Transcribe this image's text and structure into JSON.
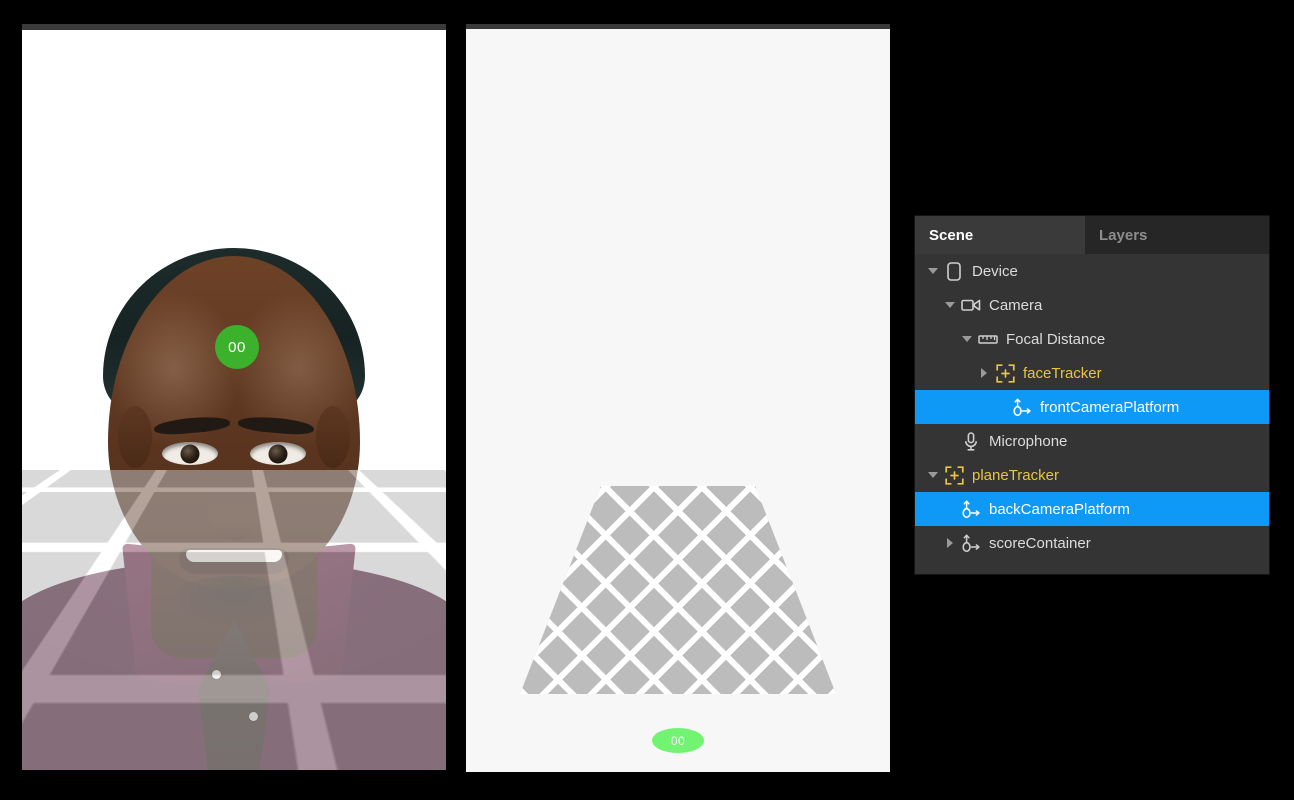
{
  "viewports": {
    "front": {
      "name": "front-camera-preview",
      "score_badge": {
        "text": "00",
        "color": "#3cb22c",
        "text_color": "#ffffff"
      },
      "background": "#ffffff",
      "floor_color": "#b9b9b9",
      "grid_line_color": "#ffffff"
    },
    "back": {
      "name": "back-camera-preview",
      "score_badge": {
        "text": "00",
        "color": "#72f472",
        "text_color": "#ffffff"
      },
      "background": "#f7f7f7",
      "plane_color": "#bcbcbc",
      "grid_line_color": "#ffffff"
    }
  },
  "scene_panel": {
    "tabs": [
      {
        "label": "Scene",
        "active": true
      },
      {
        "label": "Layers",
        "active": false
      }
    ],
    "colors": {
      "panel_background": "#343434",
      "tab_inactive_background": "#262626",
      "selection": "#0d99f5",
      "tracker_label": "#e8c545",
      "text": "#dcdcdc"
    },
    "tree": [
      {
        "label": "Device",
        "icon": "device-icon",
        "depth": 0,
        "twisty": "down",
        "selected": false,
        "accent": false
      },
      {
        "label": "Camera",
        "icon": "camera-icon",
        "depth": 1,
        "twisty": "down",
        "selected": false,
        "accent": false
      },
      {
        "label": "Focal Distance",
        "icon": "ruler-icon",
        "depth": 2,
        "twisty": "down",
        "selected": false,
        "accent": false
      },
      {
        "label": "faceTracker",
        "icon": "tracker-icon",
        "depth": 3,
        "twisty": "right",
        "selected": false,
        "accent": true
      },
      {
        "label": "frontCameraPlatform",
        "icon": "origin-icon",
        "depth": 4,
        "twisty": "none",
        "selected": true,
        "accent": false
      },
      {
        "label": "Microphone",
        "icon": "microphone-icon",
        "depth": 1,
        "twisty": "none",
        "selected": false,
        "accent": false
      },
      {
        "label": "planeTracker",
        "icon": "tracker-icon",
        "depth": 0,
        "twisty": "down",
        "selected": false,
        "accent": true
      },
      {
        "label": "backCameraPlatform",
        "icon": "origin-icon",
        "depth": 1,
        "twisty": "none",
        "selected": true,
        "accent": false
      },
      {
        "label": "scoreContainer",
        "icon": "origin-icon",
        "depth": 1,
        "twisty": "right",
        "selected": false,
        "accent": false
      }
    ]
  }
}
